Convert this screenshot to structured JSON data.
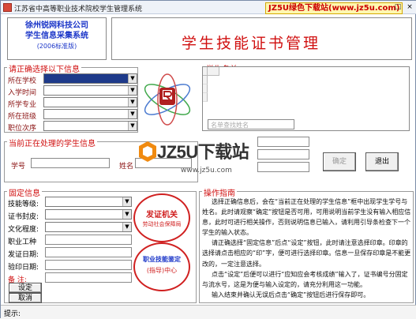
{
  "window": {
    "title": "江苏省中高等职业技术院校学生管理系统",
    "watermark": "JZ5U绿色下载站(www.jz5u.com)",
    "max_icon": "□",
    "close_icon": "×"
  },
  "company": {
    "line1": "徐州锐网科技公司",
    "line2": "学生信息采集系统",
    "line3": "(2006标准版)"
  },
  "main_title": "学生技能证书管理",
  "selection": {
    "label": "请正确选择以下信息",
    "fields": [
      {
        "label": "所在学校",
        "value": ""
      },
      {
        "label": "入学时间",
        "value": ""
      },
      {
        "label": "所学专业",
        "value": ""
      },
      {
        "label": "所在班级",
        "value": ""
      },
      {
        "label": "职位次序",
        "value": ""
      }
    ]
  },
  "students": {
    "label": "学生名单",
    "filter_placeholder": "名单查找姓名"
  },
  "current": {
    "label": "当前正在处理的学生信息",
    "student_no_label": "学号",
    "name_label": "姓名"
  },
  "actions": {
    "confirm": "确定",
    "exit": "退出"
  },
  "fixed": {
    "label": "固定信息",
    "fields": [
      {
        "label": "技能等级:",
        "value": ""
      },
      {
        "label": "证书封皮:",
        "value": ""
      },
      {
        "label": "文化程度:",
        "value": ""
      },
      {
        "label": "职业工种",
        "value": ""
      },
      {
        "label": "发证日期:",
        "value": ""
      },
      {
        "label": "验印日期:",
        "value": ""
      },
      {
        "label": "备  注:",
        "value": ""
      }
    ],
    "set_button": "设定",
    "cancel_button": "取消"
  },
  "seals": {
    "seal1_text": "发证机关",
    "seal1_sub": "劳动社会保障局",
    "seal2_text": "职业技能鉴定",
    "seal2_sub": "(指导)中心"
  },
  "help": {
    "label": "操作指南",
    "paragraphs": [
      "选择正确信息后，会在“当前正在处理的学生信息”框中出现学生学号与姓名。此时请观察“确定”按钮是否可用，可用说明当前学生没有输入相应信息，此时可进行相关操作，否则说明信息已输入，请利用引导条检查下一个学生的输入状态。",
      "请正确选择“固定信息”后点“设定”按钮，此时请注意选择印章。印章的选择请点击相应的“印”字，便可进行选择印章。信息一旦保存印章是不能更改的，一定注意选择。",
      "点击“设定”后便可以进行“应知应会考核成绩”输入了，证书编号分固定与流水号，这是为便与输入设定的，请充分利用这一功能。",
      "输入结束并确认无误后点击“确定”按钮后进行保存即可。"
    ]
  },
  "status": {
    "text": "提示:"
  },
  "overlay": {
    "brand": "JZ5U下载站",
    "url": "www.jz5u.com"
  },
  "colors": {
    "accent_red": "#d01010",
    "company_blue": "#1a35c8",
    "selected_combo": "#1e3a8a"
  }
}
